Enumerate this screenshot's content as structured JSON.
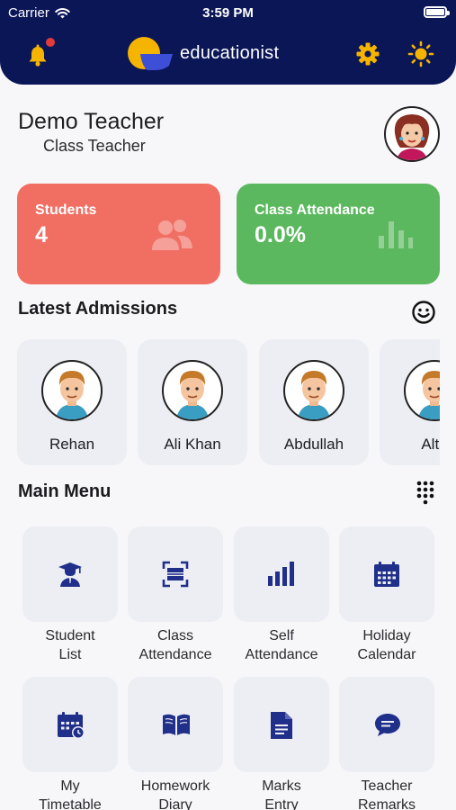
{
  "status_bar": {
    "carrier": "Carrier",
    "time": "3:59 PM"
  },
  "header": {
    "app_name": "educationist"
  },
  "profile": {
    "name": "Demo Teacher",
    "role": "Class Teacher"
  },
  "stats": {
    "students": {
      "title": "Students",
      "value": "4"
    },
    "attendance": {
      "title": "Class Attendance",
      "value": "0.0%"
    }
  },
  "admissions": {
    "title": "Latest Admissions",
    "items": [
      {
        "name": "Rehan"
      },
      {
        "name": "Ali Khan"
      },
      {
        "name": "Abdullah"
      },
      {
        "name": "Alta"
      }
    ]
  },
  "main_menu": {
    "title": "Main Menu",
    "items": [
      {
        "line1": "Student",
        "line2": "List",
        "icon": "graduate-icon"
      },
      {
        "line1": "Class",
        "line2": "Attendance",
        "icon": "scan-icon"
      },
      {
        "line1": "Self",
        "line2": "Attendance",
        "icon": "bar-chart-icon"
      },
      {
        "line1": "Holiday",
        "line2": "Calendar",
        "icon": "calendar-icon"
      },
      {
        "line1": "My",
        "line2": "Timetable",
        "icon": "timetable-icon"
      },
      {
        "line1": "Homework",
        "line2": "Diary",
        "icon": "book-icon"
      },
      {
        "line1": "Marks",
        "line2": "Entry",
        "icon": "document-icon"
      },
      {
        "line1": "Teacher",
        "line2": "Remarks",
        "icon": "chat-icon"
      }
    ]
  },
  "colors": {
    "header_bg": "#0b1657",
    "accent_yellow": "#f5b400",
    "students_card": "#f16e63",
    "attendance_card": "#5cb85f",
    "icon_navy": "#1f2f8a"
  }
}
